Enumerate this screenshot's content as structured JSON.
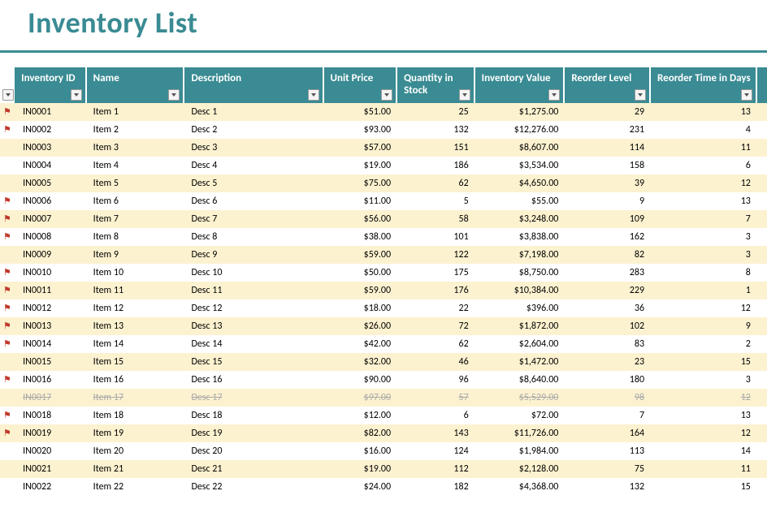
{
  "title": "Inventory List",
  "columns": {
    "id": "Inventory ID",
    "name": "Name",
    "desc": "Description",
    "price": "Unit Price",
    "qty": "Quantity in Stock",
    "value": "Inventory Value",
    "reorder": "Reorder Level",
    "days": "Reorder Time in Days"
  },
  "rows": [
    {
      "flag": true,
      "striped": true,
      "id": "IN0001",
      "name": "Item 1",
      "desc": "Desc 1",
      "price": "$51.00",
      "qty": "25",
      "value": "$1,275.00",
      "reorder": "29",
      "days": "13"
    },
    {
      "flag": true,
      "striped": false,
      "id": "IN0002",
      "name": "Item 2",
      "desc": "Desc 2",
      "price": "$93.00",
      "qty": "132",
      "value": "$12,276.00",
      "reorder": "231",
      "days": "4"
    },
    {
      "flag": false,
      "striped": true,
      "id": "IN0003",
      "name": "Item 3",
      "desc": "Desc 3",
      "price": "$57.00",
      "qty": "151",
      "value": "$8,607.00",
      "reorder": "114",
      "days": "11"
    },
    {
      "flag": false,
      "striped": false,
      "id": "IN0004",
      "name": "Item 4",
      "desc": "Desc 4",
      "price": "$19.00",
      "qty": "186",
      "value": "$3,534.00",
      "reorder": "158",
      "days": "6"
    },
    {
      "flag": false,
      "striped": true,
      "id": "IN0005",
      "name": "Item 5",
      "desc": "Desc 5",
      "price": "$75.00",
      "qty": "62",
      "value": "$4,650.00",
      "reorder": "39",
      "days": "12"
    },
    {
      "flag": true,
      "striped": false,
      "id": "IN0006",
      "name": "Item 6",
      "desc": "Desc 6",
      "price": "$11.00",
      "qty": "5",
      "value": "$55.00",
      "reorder": "9",
      "days": "13"
    },
    {
      "flag": true,
      "striped": true,
      "id": "IN0007",
      "name": "Item 7",
      "desc": "Desc 7",
      "price": "$56.00",
      "qty": "58",
      "value": "$3,248.00",
      "reorder": "109",
      "days": "7"
    },
    {
      "flag": true,
      "striped": false,
      "id": "IN0008",
      "name": "Item 8",
      "desc": "Desc 8",
      "price": "$38.00",
      "qty": "101",
      "value": "$3,838.00",
      "reorder": "162",
      "days": "3"
    },
    {
      "flag": false,
      "striped": true,
      "id": "IN0009",
      "name": "Item 9",
      "desc": "Desc 9",
      "price": "$59.00",
      "qty": "122",
      "value": "$7,198.00",
      "reorder": "82",
      "days": "3"
    },
    {
      "flag": true,
      "striped": false,
      "id": "IN0010",
      "name": "Item 10",
      "desc": "Desc 10",
      "price": "$50.00",
      "qty": "175",
      "value": "$8,750.00",
      "reorder": "283",
      "days": "8"
    },
    {
      "flag": true,
      "striped": true,
      "id": "IN0011",
      "name": "Item 11",
      "desc": "Desc 11",
      "price": "$59.00",
      "qty": "176",
      "value": "$10,384.00",
      "reorder": "229",
      "days": "1"
    },
    {
      "flag": true,
      "striped": false,
      "id": "IN0012",
      "name": "Item 12",
      "desc": "Desc 12",
      "price": "$18.00",
      "qty": "22",
      "value": "$396.00",
      "reorder": "36",
      "days": "12"
    },
    {
      "flag": true,
      "striped": true,
      "id": "IN0013",
      "name": "Item 13",
      "desc": "Desc 13",
      "price": "$26.00",
      "qty": "72",
      "value": "$1,872.00",
      "reorder": "102",
      "days": "9"
    },
    {
      "flag": true,
      "striped": false,
      "id": "IN0014",
      "name": "Item 14",
      "desc": "Desc 14",
      "price": "$42.00",
      "qty": "62",
      "value": "$2,604.00",
      "reorder": "83",
      "days": "2"
    },
    {
      "flag": false,
      "striped": true,
      "id": "IN0015",
      "name": "Item 15",
      "desc": "Desc 15",
      "price": "$32.00",
      "qty": "46",
      "value": "$1,472.00",
      "reorder": "23",
      "days": "15"
    },
    {
      "flag": true,
      "striped": false,
      "id": "IN0016",
      "name": "Item 16",
      "desc": "Desc 16",
      "price": "$90.00",
      "qty": "96",
      "value": "$8,640.00",
      "reorder": "180",
      "days": "3"
    },
    {
      "flag": false,
      "striped": true,
      "id": "IN0017",
      "name": "Item 17",
      "desc": "Desc 17",
      "price": "$97.00",
      "qty": "57",
      "value": "$5,529.00",
      "reorder": "98",
      "days": "12",
      "discontinued": true
    },
    {
      "flag": true,
      "striped": false,
      "id": "IN0018",
      "name": "Item 18",
      "desc": "Desc 18",
      "price": "$12.00",
      "qty": "6",
      "value": "$72.00",
      "reorder": "7",
      "days": "13"
    },
    {
      "flag": true,
      "striped": true,
      "id": "IN0019",
      "name": "Item 19",
      "desc": "Desc 19",
      "price": "$82.00",
      "qty": "143",
      "value": "$11,726.00",
      "reorder": "164",
      "days": "12"
    },
    {
      "flag": false,
      "striped": false,
      "id": "IN0020",
      "name": "Item 20",
      "desc": "Desc 20",
      "price": "$16.00",
      "qty": "124",
      "value": "$1,984.00",
      "reorder": "113",
      "days": "14"
    },
    {
      "flag": false,
      "striped": true,
      "id": "IN0021",
      "name": "Item 21",
      "desc": "Desc 21",
      "price": "$19.00",
      "qty": "112",
      "value": "$2,128.00",
      "reorder": "75",
      "days": "11"
    },
    {
      "flag": false,
      "striped": false,
      "id": "IN0022",
      "name": "Item 22",
      "desc": "Desc 22",
      "price": "$24.00",
      "qty": "182",
      "value": "$4,368.00",
      "reorder": "132",
      "days": "15"
    }
  ]
}
